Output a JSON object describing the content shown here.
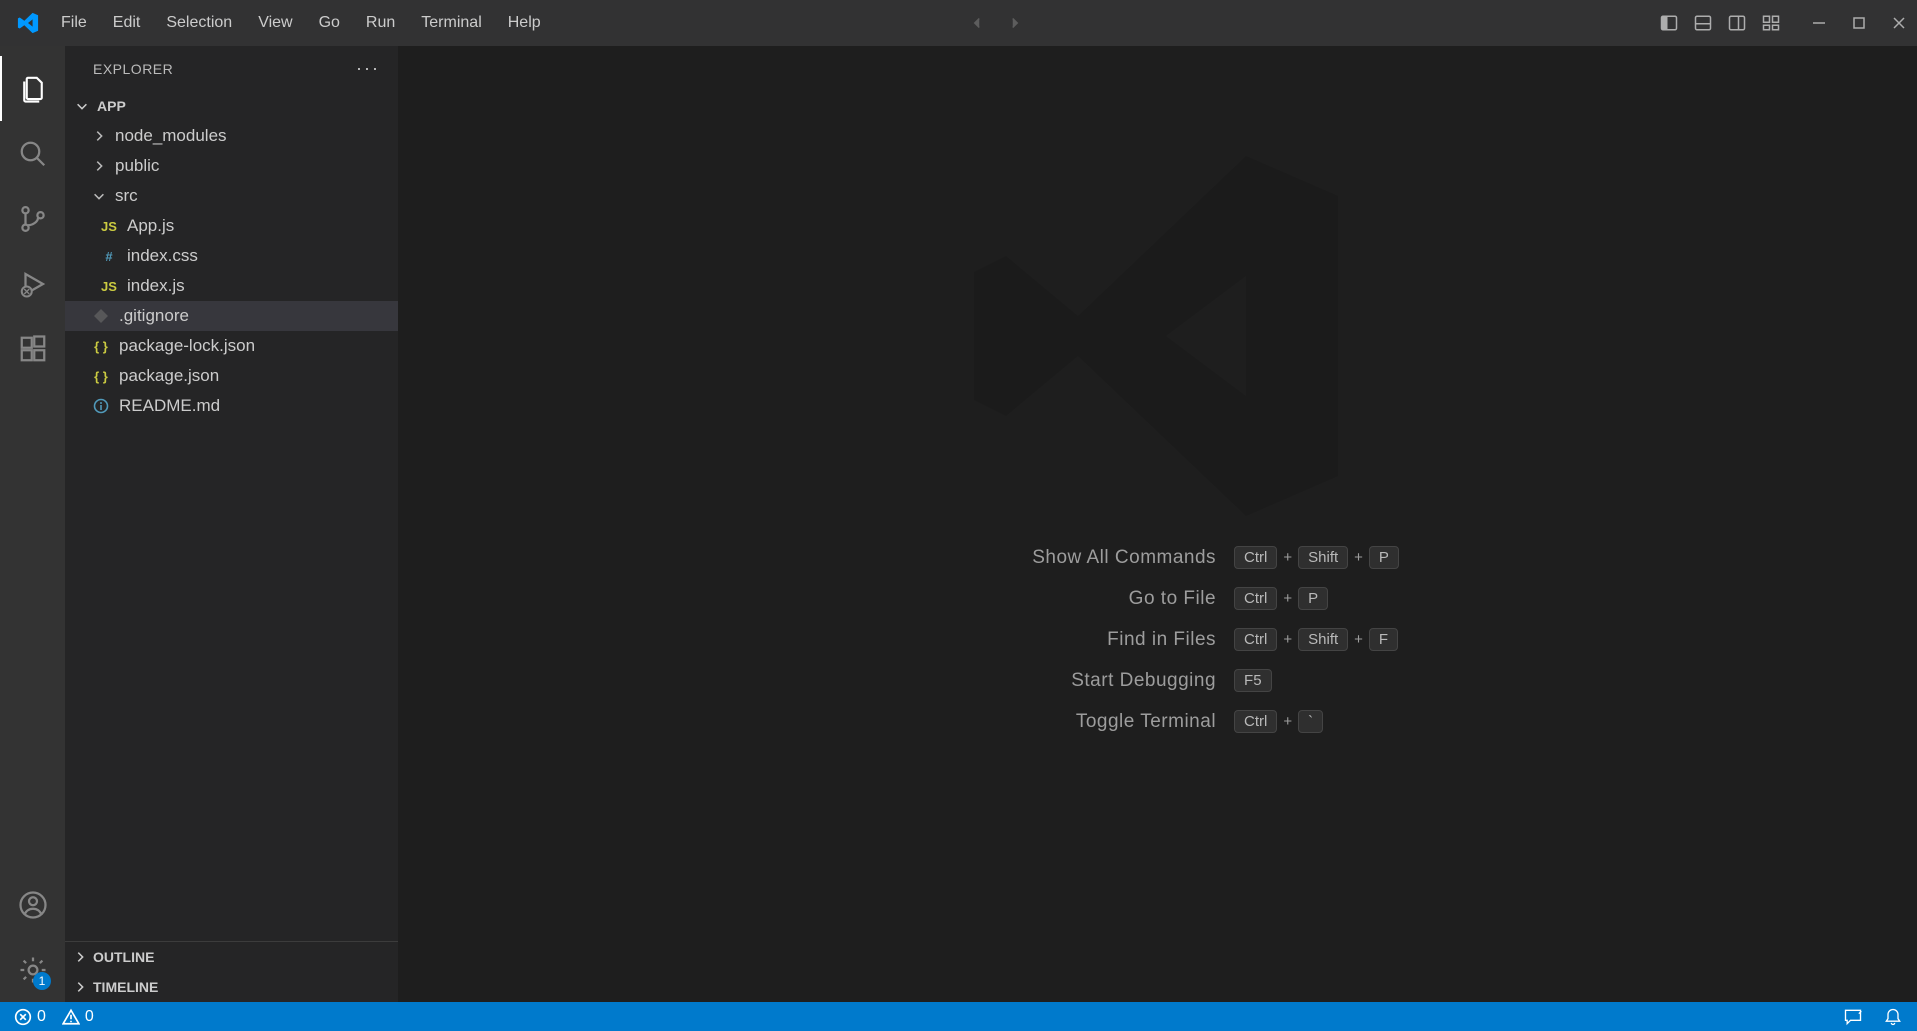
{
  "menubar": {
    "items": [
      "File",
      "Edit",
      "Selection",
      "View",
      "Go",
      "Run",
      "Terminal",
      "Help"
    ]
  },
  "activitybar": {
    "top": [
      {
        "name": "explorer",
        "icon": "files-icon",
        "active": true
      },
      {
        "name": "search",
        "icon": "search-icon",
        "active": false
      },
      {
        "name": "scm",
        "icon": "source-control-icon",
        "active": false
      },
      {
        "name": "debug",
        "icon": "debug-icon",
        "active": false
      },
      {
        "name": "extensions",
        "icon": "extensions-icon",
        "active": false
      }
    ],
    "bottom": [
      {
        "name": "accounts",
        "icon": "account-icon"
      },
      {
        "name": "manage",
        "icon": "gear-icon",
        "badge": "1"
      }
    ]
  },
  "sidebar": {
    "title": "EXPLORER",
    "root": "APP",
    "tree": [
      {
        "type": "folder",
        "name": "node_modules",
        "expanded": false,
        "depth": 1
      },
      {
        "type": "folder",
        "name": "public",
        "expanded": false,
        "depth": 1
      },
      {
        "type": "folder",
        "name": "src",
        "expanded": true,
        "depth": 1
      },
      {
        "type": "file",
        "name": "App.js",
        "icon": "js",
        "depth": 2
      },
      {
        "type": "file",
        "name": "index.css",
        "icon": "css",
        "depth": 2
      },
      {
        "type": "file",
        "name": "index.js",
        "icon": "js",
        "depth": 2
      },
      {
        "type": "file",
        "name": ".gitignore",
        "icon": "git",
        "depth": 1,
        "selected": true
      },
      {
        "type": "file",
        "name": "package-lock.json",
        "icon": "json",
        "depth": 1
      },
      {
        "type": "file",
        "name": "package.json",
        "icon": "json",
        "depth": 1
      },
      {
        "type": "file",
        "name": "README.md",
        "icon": "info",
        "depth": 1
      }
    ],
    "sections": [
      {
        "name": "OUTLINE"
      },
      {
        "name": "TIMELINE"
      }
    ]
  },
  "welcome": {
    "shortcuts": [
      {
        "label": "Show All Commands",
        "keys": [
          "Ctrl",
          "Shift",
          "P"
        ]
      },
      {
        "label": "Go to File",
        "keys": [
          "Ctrl",
          "P"
        ]
      },
      {
        "label": "Find in Files",
        "keys": [
          "Ctrl",
          "Shift",
          "F"
        ]
      },
      {
        "label": "Start Debugging",
        "keys": [
          "F5"
        ]
      },
      {
        "label": "Toggle Terminal",
        "keys": [
          "Ctrl",
          "`"
        ]
      }
    ]
  },
  "statusbar": {
    "errors": "0",
    "warnings": "0"
  }
}
